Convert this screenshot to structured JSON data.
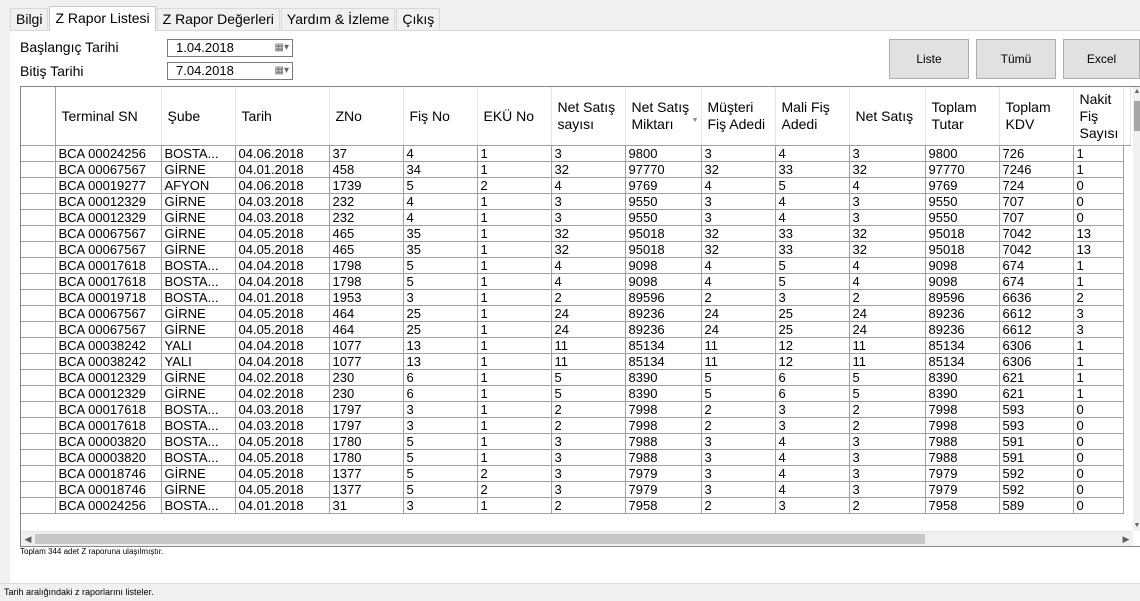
{
  "tabs": [
    "Bilgi",
    "Z Rapor Listesi",
    "Z Rapor Değerleri",
    "Yardım & İzleme",
    "Çıkış"
  ],
  "active_tab": 1,
  "filters": {
    "start_label": "Başlangıç Tarihi",
    "start_value": "1.04.2018",
    "end_label": "Bitiş Tarihi",
    "end_value": "7.04.2018"
  },
  "buttons": {
    "list": "Liste",
    "all": "Tümü",
    "excel": "Excel"
  },
  "columns": [
    "Terminal SN",
    "Şube",
    "Tarih",
    "ZNo",
    "Fiş No",
    "EKÜ No",
    "Net Satış sayısı",
    "Net Satış Miktarı",
    "Müşteri Fiş Adedi",
    "Mali Fiş Adedi",
    "Net Satış",
    "Toplam Tutar",
    "Toplam KDV",
    "Nakit Fiş Sayısı"
  ],
  "rows": [
    [
      "BCA 00024256",
      "BOSTA...",
      "04.06.2018",
      "37",
      "4",
      "1",
      "3",
      "9800",
      "3",
      "4",
      "3",
      "9800",
      "726",
      "1"
    ],
    [
      "BCA 00067567",
      "GİRNE",
      "04.01.2018",
      "458",
      "34",
      "1",
      "32",
      "97770",
      "32",
      "33",
      "32",
      "97770",
      "7246",
      "1"
    ],
    [
      "BCA 00019277",
      "AFYON",
      "04.06.2018",
      "1739",
      "5",
      "2",
      "4",
      "9769",
      "4",
      "5",
      "4",
      "9769",
      "724",
      "0"
    ],
    [
      "BCA 00012329",
      "GİRNE",
      "04.03.2018",
      "232",
      "4",
      "1",
      "3",
      "9550",
      "3",
      "4",
      "3",
      "9550",
      "707",
      "0"
    ],
    [
      "BCA 00012329",
      "GİRNE",
      "04.03.2018",
      "232",
      "4",
      "1",
      "3",
      "9550",
      "3",
      "4",
      "3",
      "9550",
      "707",
      "0"
    ],
    [
      "BCA 00067567",
      "GİRNE",
      "04.05.2018",
      "465",
      "35",
      "1",
      "32",
      "95018",
      "32",
      "33",
      "32",
      "95018",
      "7042",
      "13"
    ],
    [
      "BCA 00067567",
      "GİRNE",
      "04.05.2018",
      "465",
      "35",
      "1",
      "32",
      "95018",
      "32",
      "33",
      "32",
      "95018",
      "7042",
      "13"
    ],
    [
      "BCA 00017618",
      "BOSTA...",
      "04.04.2018",
      "1798",
      "5",
      "1",
      "4",
      "9098",
      "4",
      "5",
      "4",
      "9098",
      "674",
      "1"
    ],
    [
      "BCA 00017618",
      "BOSTA...",
      "04.04.2018",
      "1798",
      "5",
      "1",
      "4",
      "9098",
      "4",
      "5",
      "4",
      "9098",
      "674",
      "1"
    ],
    [
      "BCA 00019718",
      "BOSTA...",
      "04.01.2018",
      "1953",
      "3",
      "1",
      "2",
      "89596",
      "2",
      "3",
      "2",
      "89596",
      "6636",
      "2"
    ],
    [
      "BCA 00067567",
      "GİRNE",
      "04.05.2018",
      "464",
      "25",
      "1",
      "24",
      "89236",
      "24",
      "25",
      "24",
      "89236",
      "6612",
      "3"
    ],
    [
      "BCA 00067567",
      "GİRNE",
      "04.05.2018",
      "464",
      "25",
      "1",
      "24",
      "89236",
      "24",
      "25",
      "24",
      "89236",
      "6612",
      "3"
    ],
    [
      "BCA 00038242",
      "YALI",
      "04.04.2018",
      "1077",
      "13",
      "1",
      "11",
      "85134",
      "11",
      "12",
      "11",
      "85134",
      "6306",
      "1"
    ],
    [
      "BCA 00038242",
      "YALI",
      "04.04.2018",
      "1077",
      "13",
      "1",
      "11",
      "85134",
      "11",
      "12",
      "11",
      "85134",
      "6306",
      "1"
    ],
    [
      "BCA 00012329",
      "GİRNE",
      "04.02.2018",
      "230",
      "6",
      "1",
      "5",
      "8390",
      "5",
      "6",
      "5",
      "8390",
      "621",
      "1"
    ],
    [
      "BCA 00012329",
      "GİRNE",
      "04.02.2018",
      "230",
      "6",
      "1",
      "5",
      "8390",
      "5",
      "6",
      "5",
      "8390",
      "621",
      "1"
    ],
    [
      "BCA 00017618",
      "BOSTA...",
      "04.03.2018",
      "1797",
      "3",
      "1",
      "2",
      "7998",
      "2",
      "3",
      "2",
      "7998",
      "593",
      "0"
    ],
    [
      "BCA 00017618",
      "BOSTA...",
      "04.03.2018",
      "1797",
      "3",
      "1",
      "2",
      "7998",
      "2",
      "3",
      "2",
      "7998",
      "593",
      "0"
    ],
    [
      "BCA 00003820",
      "BOSTA...",
      "04.05.2018",
      "1780",
      "5",
      "1",
      "3",
      "7988",
      "3",
      "4",
      "3",
      "7988",
      "591",
      "0"
    ],
    [
      "BCA 00003820",
      "BOSTA...",
      "04.05.2018",
      "1780",
      "5",
      "1",
      "3",
      "7988",
      "3",
      "4",
      "3",
      "7988",
      "591",
      "0"
    ],
    [
      "BCA 00018746",
      "GİRNE",
      "04.05.2018",
      "1377",
      "5",
      "2",
      "3",
      "7979",
      "3",
      "4",
      "3",
      "7979",
      "592",
      "0"
    ],
    [
      "BCA 00018746",
      "GİRNE",
      "04.05.2018",
      "1377",
      "5",
      "2",
      "3",
      "7979",
      "3",
      "4",
      "3",
      "7979",
      "592",
      "0"
    ],
    [
      "BCA 00024256",
      "BOSTA...",
      "04.01.2018",
      "31",
      "3",
      "1",
      "2",
      "7958",
      "2",
      "3",
      "2",
      "7958",
      "589",
      "0"
    ]
  ],
  "count_text": "Toplam 344 adet Z raporuna ulaşılmıştır.",
  "status_text": "Tarih aralığındaki z raporlarını listeler."
}
